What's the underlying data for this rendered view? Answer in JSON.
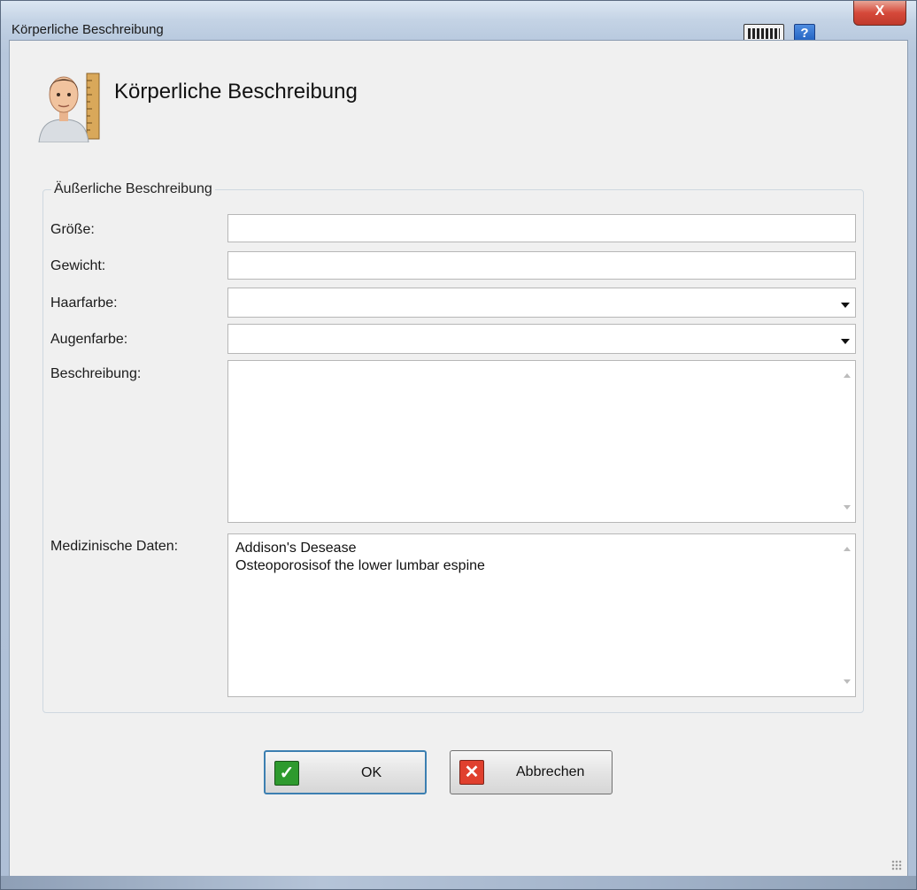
{
  "window": {
    "title": "Körperliche Beschreibung",
    "close_glyph": "X",
    "help_glyph": "?",
    "icons": {
      "keyboard": "keyboard-icon",
      "help": "help-icon",
      "close": "close-icon"
    }
  },
  "header": {
    "title": "Körperliche Beschreibung",
    "avatar_icon": "person-with-ruler-icon"
  },
  "group": {
    "legend": "Äußerliche Beschreibung",
    "fields": {
      "groesse": {
        "label": "Größe:",
        "value": ""
      },
      "gewicht": {
        "label": "Gewicht:",
        "value": ""
      },
      "haarfarbe": {
        "label": "Haarfarbe:",
        "value": ""
      },
      "augenfarbe": {
        "label": "Augenfarbe:",
        "value": ""
      },
      "beschreibung": {
        "label": "Beschreibung:",
        "value": ""
      },
      "medizin": {
        "label": "Medizinische Daten:",
        "lines": [
          "Addison's Desease",
          "Osteoporosisof the lower lumbar espine"
        ]
      }
    }
  },
  "buttons": {
    "ok": {
      "label": "OK",
      "icon": "checkmark-icon",
      "glyph": "✓",
      "color": "#2e9a2e"
    },
    "cancel": {
      "label": "Abbrechen",
      "icon": "x-icon",
      "glyph": "✕",
      "color": "#e0402e"
    }
  },
  "colors": {
    "close_button": "#d6493a",
    "help_icon": "#2f6fd1",
    "default_button_border": "#3c7fb1"
  }
}
